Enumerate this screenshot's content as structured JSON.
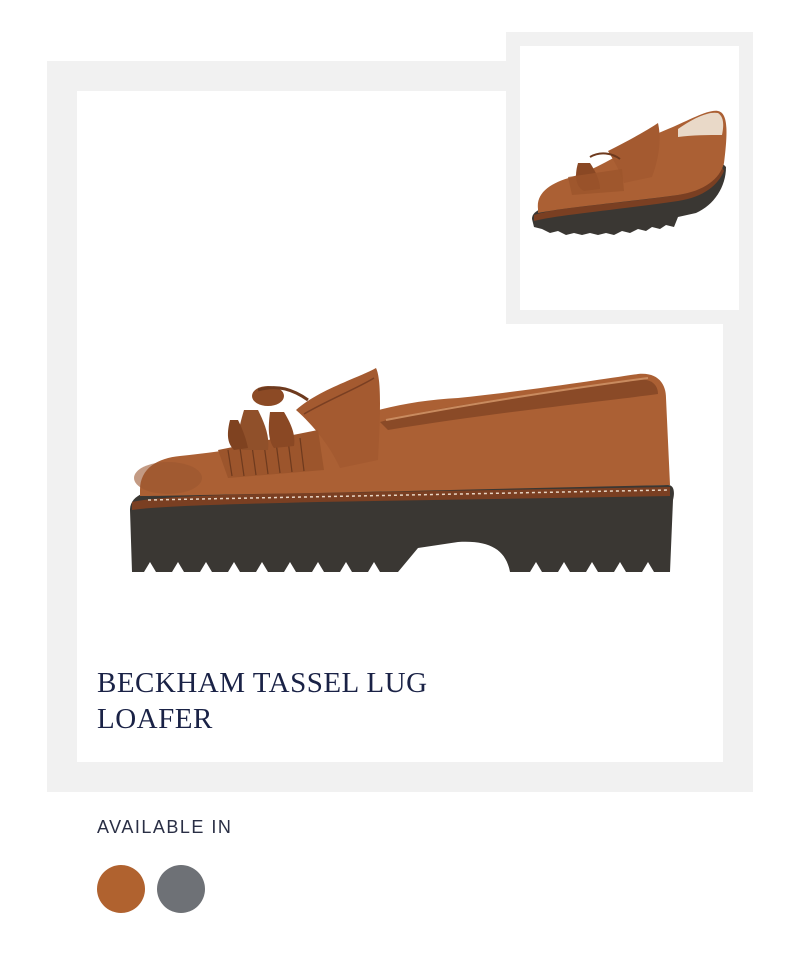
{
  "product": {
    "name": "BECKHAM TASSEL LUG LOAFER"
  },
  "availability": {
    "label": "AVAILABLE IN",
    "swatches": [
      {
        "color": "#b0622f"
      },
      {
        "color": "#6e7176"
      }
    ]
  },
  "images": {
    "main": "loafer-side-view",
    "thumbnail": "loafer-angle-view"
  }
}
